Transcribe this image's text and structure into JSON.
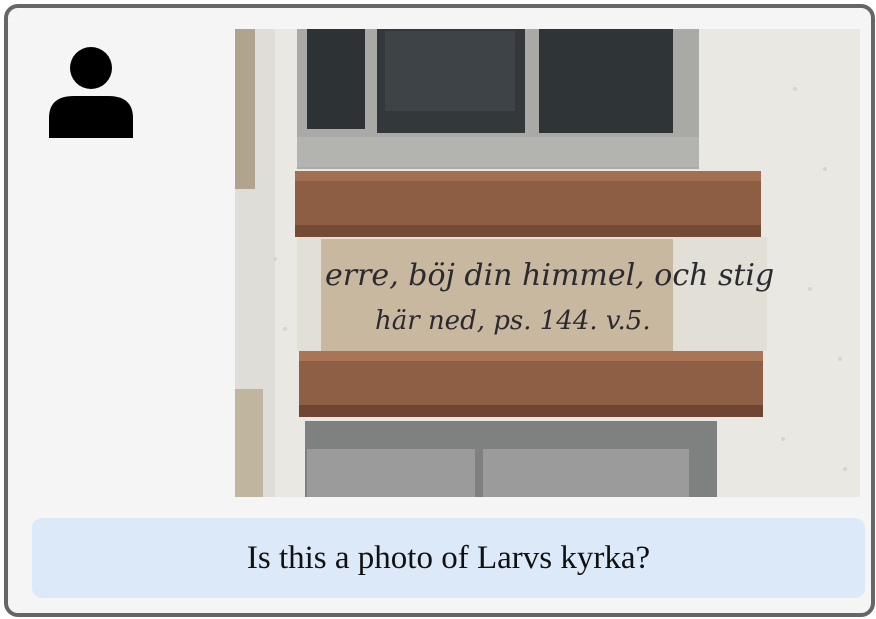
{
  "user": {
    "avatar_icon": "person-icon"
  },
  "photo": {
    "inscription_line1": "erre, böj din himmel, och stig",
    "inscription_line2": "här ned, ps. 144. v.5."
  },
  "message": {
    "text": "Is this a photo of Larvs kyrka?"
  },
  "colors": {
    "panel_bg": "#f5f5f5",
    "panel_border": "#666666",
    "caption_bg": "#dce9f8",
    "avatar": "#000000"
  }
}
